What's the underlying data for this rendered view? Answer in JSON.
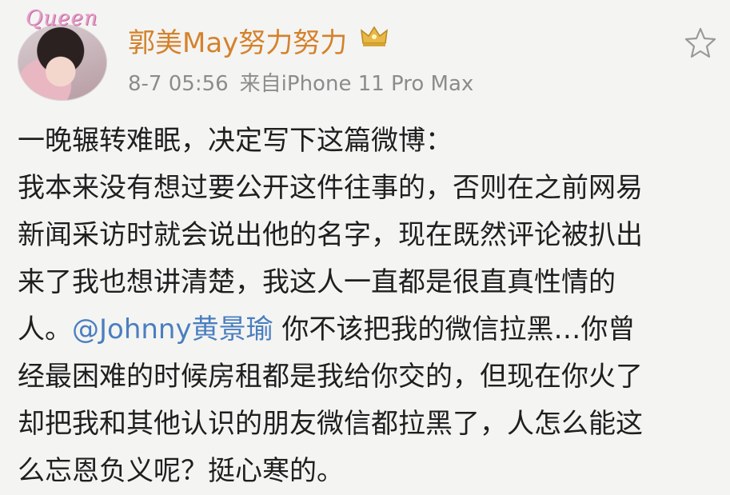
{
  "post": {
    "avatar_badge": "Queen",
    "username": "郭美May努力努力",
    "timestamp": "8-7 05:56",
    "source": "来自iPhone 11 Pro Max",
    "content_lines": [
      "一晚辗转难眠，决定写下这篇微博：",
      "我本来没有想过要公开这件往事的，否则在之前网易",
      "新闻采访时就会说出他的名字，现在既然评论被扒出",
      "来了我也想讲清楚，我这人一直都是很直真性情的",
      "人。",
      "@Johnny黄景瑜",
      " 你不该把我的微信拉黑…你曾",
      "经最困难的时候房租都是我给你交的，但现在你火了",
      "却把我和其他认识的朋友微信都拉黑了，人怎么能这",
      "么忘恩负义呢？挺心寒的。"
    ]
  },
  "icons": {
    "crown": "crown-icon",
    "favorite": "star-icon"
  },
  "colors": {
    "username": "#d4822c",
    "mention": "#4a7fc0",
    "meta": "#8c8c8c"
  }
}
